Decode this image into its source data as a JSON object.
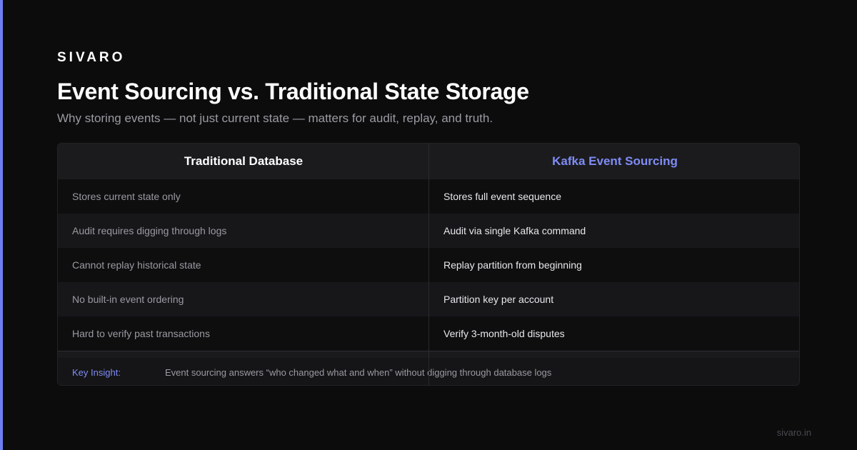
{
  "brand": "SIVARO",
  "title": "Event Sourcing vs. Traditional State Storage",
  "subtitle": "Why storing events — not just current state — matters for audit, replay, and truth.",
  "table": {
    "headers": [
      "Traditional Database",
      "Kafka Event Sourcing"
    ],
    "rows": [
      [
        "Stores current state only",
        "Stores full event sequence"
      ],
      [
        "Audit requires digging through logs",
        "Audit via single Kafka command"
      ],
      [
        "Cannot replay historical state",
        "Replay partition from beginning"
      ],
      [
        "No built-in event ordering",
        "Partition key per account"
      ],
      [
        "Hard to verify past transactions",
        "Verify 3-month-old disputes"
      ]
    ]
  },
  "insight": {
    "label": "Key Insight:",
    "text": "Event sourcing answers “who changed what and when” without digging through database logs"
  },
  "footer": {
    "site": "sivaro.in"
  },
  "colors": {
    "accent": "#6e7ff3",
    "header_accent": "#7f8cf5",
    "background": "#0c0c0d"
  }
}
